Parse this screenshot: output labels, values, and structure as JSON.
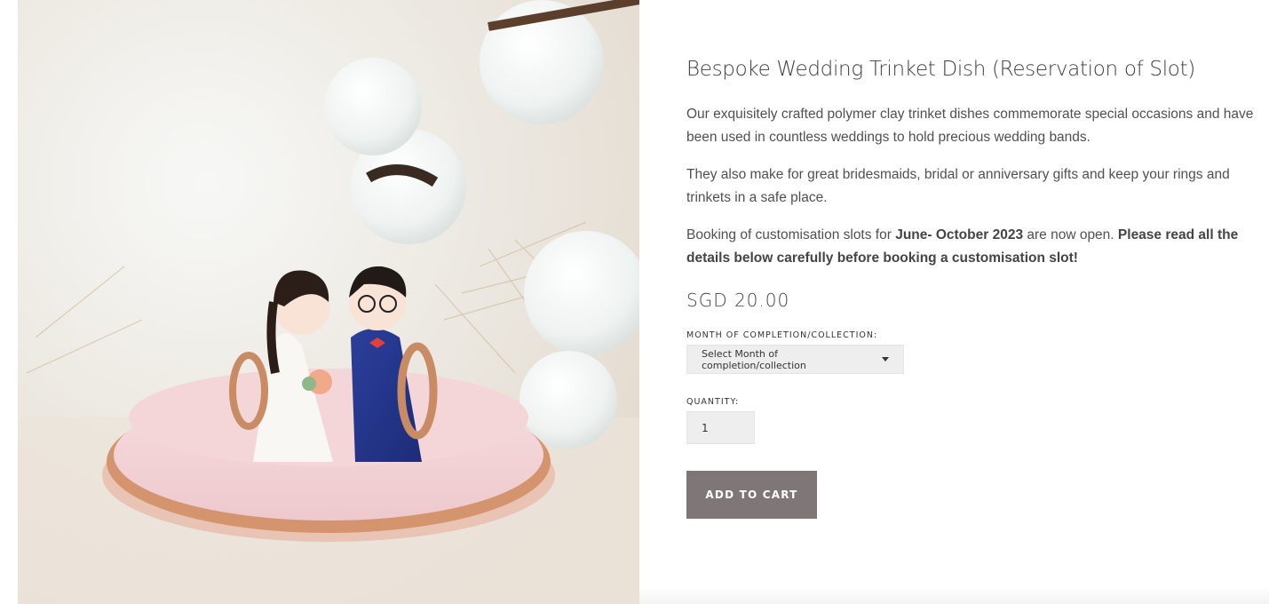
{
  "product": {
    "title": "Bespoke Wedding Trinket Dish (Reservation of Slot)",
    "description_1": "Our exquisitely crafted polymer clay trinket dishes commemorate special occasions and have been used in countless weddings to hold precious wedding bands.",
    "description_2": "They also make for great bridesmaids, bridal or anniversary gifts and keep your rings and trinkets in a safe place.",
    "booking": {
      "prefix": "Booking of customisation slots for ",
      "period": "June- October 2023",
      "middle": " are now open. ",
      "notice": "Please read all the details below carefully before booking a customisation slot!"
    },
    "price": "SGD 20.00"
  },
  "form": {
    "month_label": "MONTH OF COMPLETION/COLLECTION:",
    "month_selected": "Select Month of completion/collection",
    "quantity_label": "QUANTITY:",
    "quantity_value": "1",
    "add_to_cart_label": "ADD TO CART"
  },
  "colors": {
    "button": "#7f7777",
    "field_bg": "#eeeeee",
    "text": "#4a4a4a"
  }
}
